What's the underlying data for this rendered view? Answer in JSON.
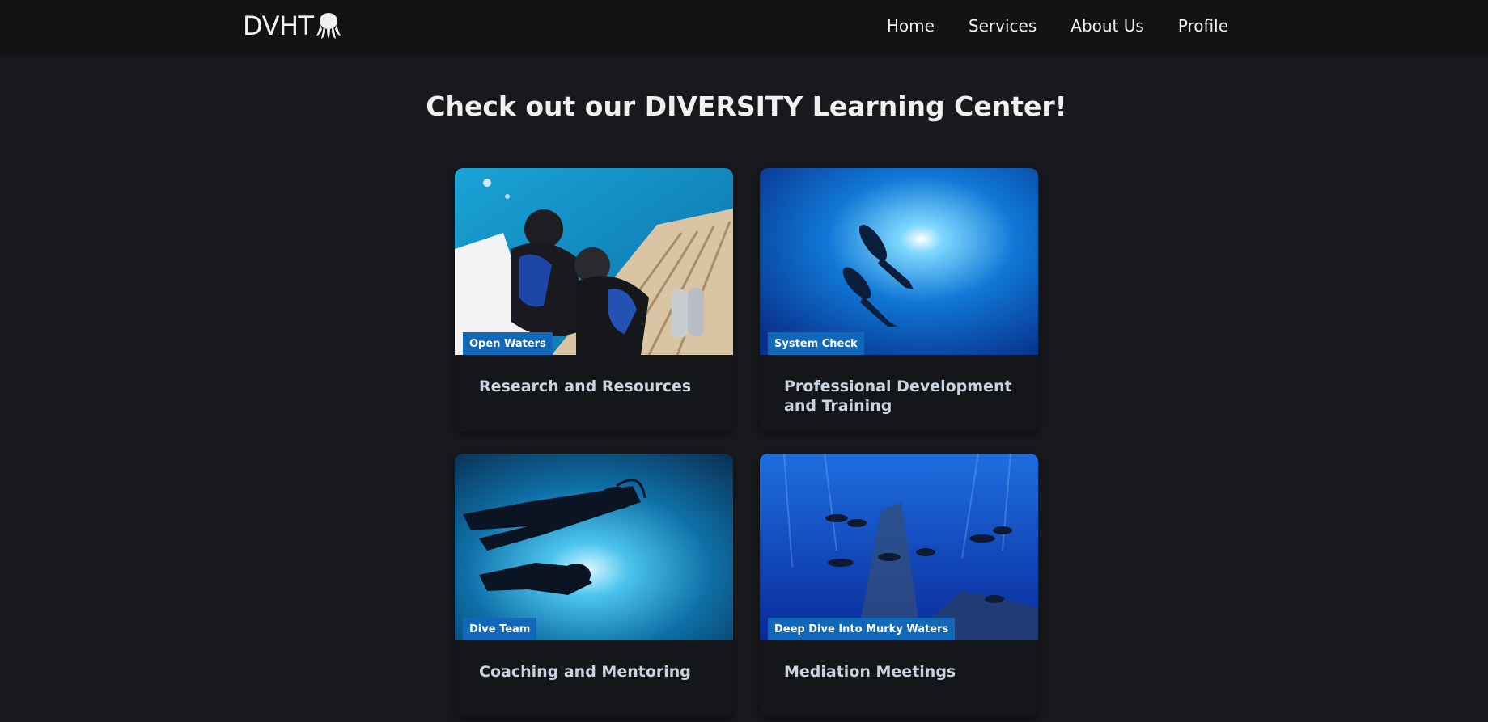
{
  "header": {
    "brand": "DVHT",
    "logo_icon": "octopus-icon",
    "nav": [
      {
        "label": "Home"
      },
      {
        "label": "Services"
      },
      {
        "label": "About Us"
      },
      {
        "label": "Profile"
      }
    ]
  },
  "main": {
    "title": "Check out our DIVERSITY Learning Center!",
    "cards": [
      {
        "badge": "Open Waters",
        "title": "Research and Resources"
      },
      {
        "badge": "System Check",
        "title": "Professional Development and Training"
      },
      {
        "badge": "Dive Team",
        "title": "Coaching and Mentoring"
      },
      {
        "badge": "Deep Dive Into Murky Waters",
        "title": "Mediation Meetings"
      }
    ]
  },
  "colors": {
    "page_bg": "#17191c",
    "navbar_bg": "#121315",
    "card_bg": "#141619",
    "badge_bg": "#1268b8",
    "card_title": "#c9d2de"
  }
}
